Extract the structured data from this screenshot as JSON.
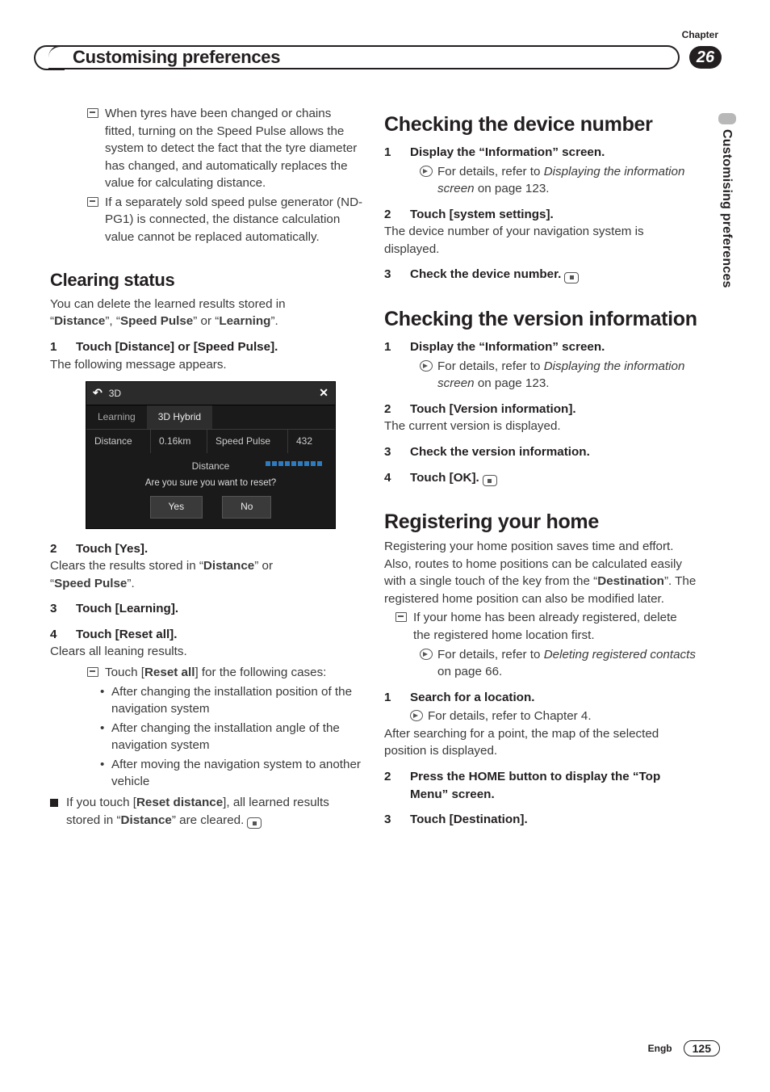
{
  "chapterLabel": "Chapter",
  "chapterNumber": "26",
  "headerTitle": "Customising preferences",
  "sideTab": "Customising preferences",
  "footer": {
    "lang": "Engb",
    "page": "125"
  },
  "left": {
    "note1": "When tyres have been changed or chains fitted, turning on the Speed Pulse allows the system to detect the fact that the tyre diameter has changed, and automatically replaces the value for calculating distance.",
    "note2": "If a separately sold speed pulse generator (ND-PG1) is connected, the distance calculation value cannot be replaced automatically.",
    "clearing": {
      "title": "Clearing status",
      "intro1": "You can delete the learned results stored in",
      "intro2a": "“",
      "dist": "Distance",
      "intro2b": "”, “",
      "sp": "Speed Pulse",
      "intro2c": "” or “",
      "learn": "Learning",
      "intro2d": "”.",
      "step1": "Touch [Distance] or [Speed Pulse].",
      "step1body": "The following message appears.",
      "step2": "Touch [Yes].",
      "step2body_a": "Clears the results stored in “",
      "step2body_b": "” or",
      "step2body_c": "“",
      "step2body_d": "”.",
      "step3": "Touch [Learning].",
      "step4": "Touch [Reset all].",
      "step4body": "Clears all leaning results.",
      "resetIntro_a": "Touch [",
      "resetIntro_b": "Reset all",
      "resetIntro_c": "] for the following cases:",
      "b1": "After changing the installation position of the navigation system",
      "b2": "After changing the installation angle of the navigation system",
      "b3": "After moving the navigation system to another vehicle",
      "sq_a": "If you touch [",
      "sq_b": "Reset distance",
      "sq_c": "], all learned results stored in “",
      "sq_d": "” are cleared."
    },
    "shot": {
      "title": "3D",
      "tabLearning": "Learning",
      "tabHybrid": "3D Hybrid",
      "cellDistance": "Distance",
      "cellDistVal": "0.16km",
      "cellSP": "Speed Pulse",
      "cellSPVal": "432",
      "subtitle": "Distance",
      "msg": "Are you sure you want to reset?",
      "yes": "Yes",
      "no": "No"
    }
  },
  "right": {
    "deviceTitle": "Checking the device number",
    "dev_s1": "Display the “Information” screen.",
    "dev_ref_a": "For details, refer to ",
    "dev_ref_i": "Displaying the information screen",
    "dev_ref_b": " on page 123.",
    "dev_s2": "Touch [system settings].",
    "dev_s2body": "The device number of your navigation system is displayed.",
    "dev_s3": "Check the device number.",
    "verTitle": "Checking the version information",
    "ver_s1": "Display the “Information” screen.",
    "ver_ref_a": "For details, refer to ",
    "ver_ref_i": "Displaying the information screen",
    "ver_ref_b": " on page 123.",
    "ver_s2": "Touch [Version information].",
    "ver_s2body": "The current version is displayed.",
    "ver_s3": "Check the version information.",
    "ver_s4": "Touch [OK].",
    "homeTitle": "Registering your home",
    "home_p1_a": "Registering your home position saves time and effort. Also, routes to home positions can be calculated easily with a single touch of the key from the “",
    "home_p1_b": "Destination",
    "home_p1_c": "”. The registered home position can also be modified later.",
    "home_note": "If your home has been already registered, delete the registered home location first.",
    "home_ref_a": "For details, refer to ",
    "home_ref_i": "Deleting registered contacts",
    "home_ref_b": " on page 66.",
    "home_s1": "Search for a location.",
    "home_s1ref": "For details, refer to Chapter 4.",
    "home_s1body": "After searching for a point, the map of the selected position is displayed.",
    "home_s2": "Press the HOME button to display the “Top Menu” screen.",
    "home_s3": "Touch [Destination]."
  }
}
